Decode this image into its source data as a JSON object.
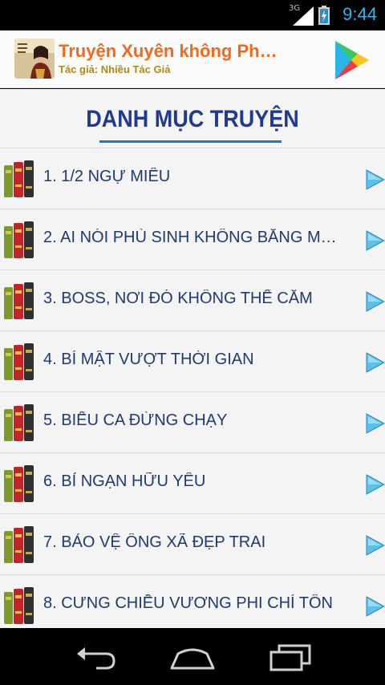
{
  "status_bar": {
    "network": "3G",
    "time": "9:44"
  },
  "app_bar": {
    "title": "Truyện Xuyên không Ph…",
    "author": "Tác giả: Nhiều Tác Giả",
    "play_icon": "google-play-icon"
  },
  "content": {
    "heading": "DANH MỤC TRUYỆN",
    "items": [
      {
        "label": "1. 1/2 NGỰ MIÊU"
      },
      {
        "label": "2. AI NÓI PHÙ SINH KHÔNG BẰNG MỘ…"
      },
      {
        "label": "3. BOSS, NƠI ĐÓ KHÔNG THỂ CẮM"
      },
      {
        "label": "4. BÍ MẬT VƯỢT THỜI GIAN"
      },
      {
        "label": "5. BIỂU CA ĐỪNG CHẠY"
      },
      {
        "label": "6. BỈ NGẠN HỮU YÊU"
      },
      {
        "label": "7. BẢO VỆ ÔNG XÃ ĐẸP TRAI"
      },
      {
        "label": "8. CƯNG CHIỀU VƯƠNG PHI CHÍ TÔN"
      }
    ]
  },
  "nav_bar": {
    "back": "back-icon",
    "home": "home-icon",
    "recents": "recents-icon"
  },
  "colors": {
    "title": "#f06a1a",
    "author": "#b08a10",
    "heading": "#1f3a93",
    "item_text": "#1e3b70",
    "arrow": "#3aa9d9",
    "time": "#33b5e5"
  }
}
